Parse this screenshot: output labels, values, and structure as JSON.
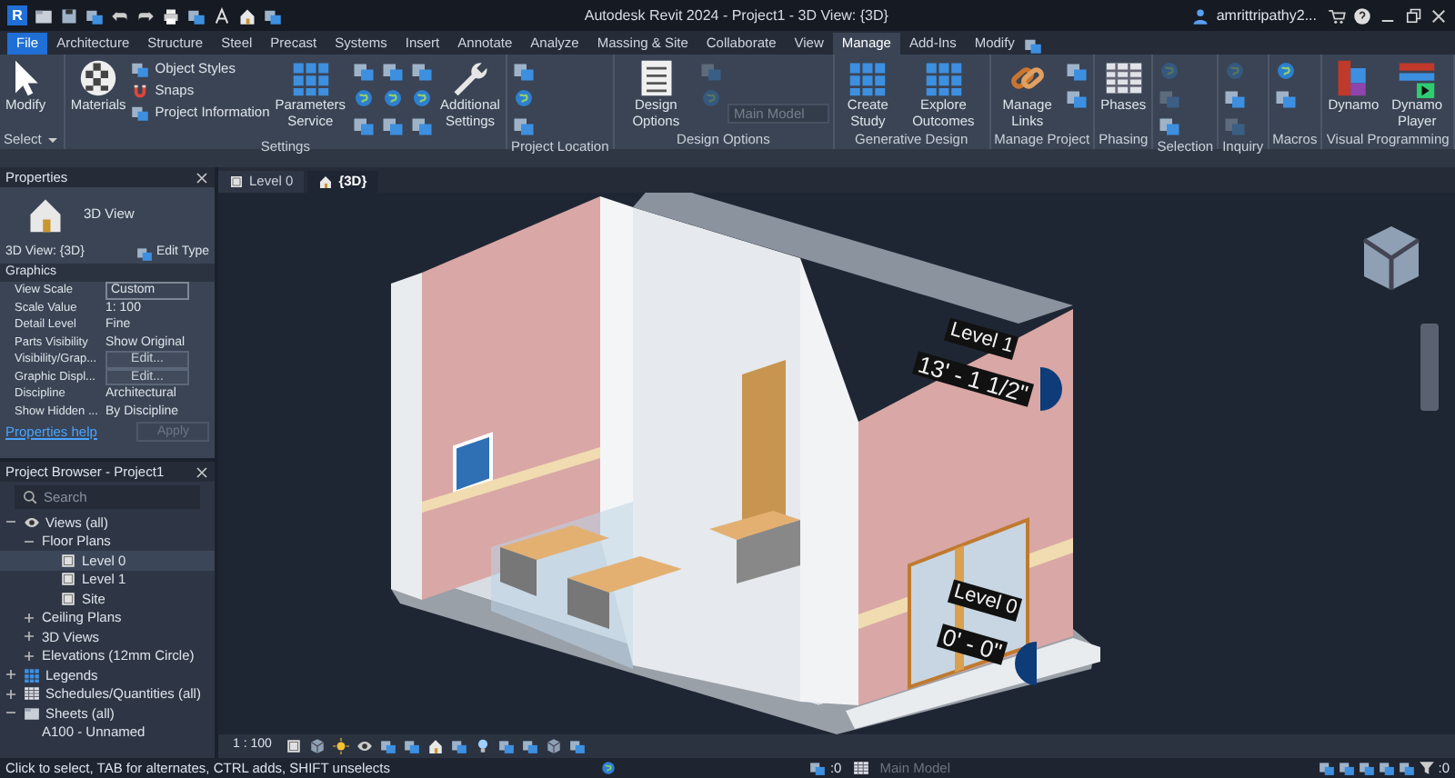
{
  "title_bar": {
    "app_letter": "R",
    "title": "Autodesk Revit 2024 - Project1 - 3D View: {3D}",
    "user": "amrittripathy2..."
  },
  "ribbon_tabs": [
    {
      "label": "File",
      "selected": false,
      "kind": "file"
    },
    {
      "label": "Architecture",
      "selected": false,
      "kind": "tab"
    },
    {
      "label": "Structure",
      "selected": false,
      "kind": "tab"
    },
    {
      "label": "Steel",
      "selected": false,
      "kind": "tab"
    },
    {
      "label": "Precast",
      "selected": false,
      "kind": "tab"
    },
    {
      "label": "Systems",
      "selected": false,
      "kind": "tab"
    },
    {
      "label": "Insert",
      "selected": false,
      "kind": "tab"
    },
    {
      "label": "Annotate",
      "selected": false,
      "kind": "tab"
    },
    {
      "label": "Analyze",
      "selected": false,
      "kind": "tab"
    },
    {
      "label": "Massing & Site",
      "selected": false,
      "kind": "tab"
    },
    {
      "label": "Collaborate",
      "selected": false,
      "kind": "tab"
    },
    {
      "label": "View",
      "selected": false,
      "kind": "tab"
    },
    {
      "label": "Manage",
      "selected": true,
      "kind": "tab"
    },
    {
      "label": "Add-Ins",
      "selected": false,
      "kind": "tab"
    },
    {
      "label": "Modify",
      "selected": false,
      "kind": "tab"
    }
  ],
  "ribbon_panels": [
    {
      "title": "Select",
      "dropdown": true,
      "buttons": [
        {
          "kind": "large",
          "label": "Modify",
          "disabled": false
        }
      ]
    },
    {
      "title": "Settings",
      "buttons": [
        {
          "kind": "large",
          "label": "Materials",
          "disabled": false
        },
        {
          "kind": "small",
          "label": "Object  Styles",
          "disabled": false
        },
        {
          "kind": "small",
          "label": "Snaps",
          "disabled": false
        },
        {
          "kind": "small",
          "label": "Project  Information",
          "disabled": false
        },
        {
          "kind": "large",
          "label": "Parameters Service",
          "disabled": false
        },
        {
          "kind": "icon",
          "disabled": false
        },
        {
          "kind": "icon",
          "disabled": false
        },
        {
          "kind": "icon",
          "disabled": false
        },
        {
          "kind": "icon",
          "disabled": false
        },
        {
          "kind": "icon",
          "disabled": false
        },
        {
          "kind": "icon",
          "disabled": false
        },
        {
          "kind": "icon",
          "disabled": false
        },
        {
          "kind": "icon",
          "disabled": false
        },
        {
          "kind": "icon",
          "disabled": false
        },
        {
          "kind": "large",
          "label": "Additional Settings",
          "disabled": false
        }
      ]
    },
    {
      "title": "Project Location",
      "buttons": [
        {
          "kind": "icon",
          "disabled": false
        },
        {
          "kind": "icon",
          "disabled": false
        },
        {
          "kind": "icon",
          "disabled": false
        }
      ]
    },
    {
      "title": "Design Options",
      "buttons": [
        {
          "kind": "large",
          "label": "Design Options",
          "disabled": false
        },
        {
          "kind": "icon",
          "disabled": true
        },
        {
          "kind": "icon",
          "disabled": true
        },
        {
          "kind": "field",
          "value": "Main Model",
          "disabled": true
        }
      ]
    },
    {
      "title": "Generative Design",
      "buttons": [
        {
          "kind": "large",
          "label": "Create Study",
          "disabled": false
        },
        {
          "kind": "large",
          "label": "Explore Outcomes",
          "disabled": false
        }
      ]
    },
    {
      "title": "Manage Project",
      "buttons": [
        {
          "kind": "large",
          "label": "Manage Links",
          "disabled": false
        },
        {
          "kind": "icon",
          "disabled": false
        },
        {
          "kind": "icon",
          "disabled": false
        }
      ]
    },
    {
      "title": "Phasing",
      "buttons": [
        {
          "kind": "large",
          "label": "Phases",
          "disabled": false
        }
      ]
    },
    {
      "title": "Selection",
      "buttons": [
        {
          "kind": "icon",
          "disabled": true
        },
        {
          "kind": "icon",
          "disabled": true
        },
        {
          "kind": "icon",
          "disabled": false
        }
      ]
    },
    {
      "title": "Inquiry",
      "buttons": [
        {
          "kind": "icon",
          "disabled": true
        },
        {
          "kind": "icon",
          "disabled": false
        },
        {
          "kind": "icon",
          "disabled": true
        }
      ]
    },
    {
      "title": "Macros",
      "buttons": [
        {
          "kind": "icon",
          "disabled": false
        },
        {
          "kind": "icon",
          "disabled": false
        }
      ]
    },
    {
      "title": "Visual Programming",
      "buttons": [
        {
          "kind": "large",
          "label": "Dynamo",
          "disabled": false
        },
        {
          "kind": "large",
          "label": "Dynamo Player",
          "disabled": false
        }
      ]
    }
  ],
  "properties": {
    "title": "Properties",
    "type_name": "3D View",
    "type_selector": "3D View: {3D}",
    "edit_type": "Edit Type",
    "group": "Graphics",
    "rows": [
      {
        "label": "View Scale",
        "value": "Custom",
        "kind": "field"
      },
      {
        "label": "Scale Value",
        "value": "1: 100",
        "kind": "text"
      },
      {
        "label": "Detail Level",
        "value": "Fine",
        "kind": "text"
      },
      {
        "label": "Parts Visibility",
        "value": "Show Original",
        "kind": "text"
      },
      {
        "label": "Visibility/Grap...",
        "value": "Edit...",
        "kind": "button"
      },
      {
        "label": "Graphic Displ...",
        "value": "Edit...",
        "kind": "button"
      },
      {
        "label": "Discipline",
        "value": "Architectural",
        "kind": "text"
      },
      {
        "label": "Show Hidden ...",
        "value": "By Discipline",
        "kind": "text"
      }
    ],
    "help_link": "Properties help",
    "apply": {
      "label": "Apply",
      "disabled": true
    }
  },
  "project_browser": {
    "title": "Project Browser - Project1",
    "search": {
      "placeholder": "Search"
    },
    "tree": [
      {
        "label": "Views (all)",
        "expanded": true,
        "selected": false,
        "children": [
          {
            "label": "Floor Plans",
            "expanded": true,
            "selected": false,
            "children": [
              {
                "label": "Level 0",
                "selected": true
              },
              {
                "label": "Level 1",
                "selected": false
              },
              {
                "label": "Site",
                "selected": false
              }
            ]
          },
          {
            "label": "Ceiling Plans",
            "expanded": false,
            "selected": false
          },
          {
            "label": "3D Views",
            "expanded": false,
            "selected": false
          },
          {
            "label": "Elevations (12mm Circle)",
            "expanded": false,
            "selected": false
          }
        ]
      },
      {
        "label": "Legends",
        "expanded": false,
        "selected": false
      },
      {
        "label": "Schedules/Quantities (all)",
        "expanded": false,
        "selected": false
      },
      {
        "label": "Sheets (all)",
        "expanded": true,
        "selected": false,
        "children": [
          {
            "label": "A100 - Unnamed",
            "selected": false
          }
        ]
      }
    ]
  },
  "view_tabs": [
    {
      "label": "Level 0",
      "selected": false
    },
    {
      "label": "{3D}",
      "selected": true
    }
  ],
  "level_tags": [
    {
      "name": "Level 1",
      "elevation": "13' - 1 1/2\""
    },
    {
      "name": "Level 0",
      "elevation": "0' - 0\""
    }
  ],
  "view_control_bar": {
    "scale": "1 : 100"
  },
  "status_bar": {
    "message": "Click to select, TAB for alternates, CTRL adds, SHIFT unselects",
    "worksets": ":0",
    "model": "Main Model",
    "filter": ":0"
  }
}
